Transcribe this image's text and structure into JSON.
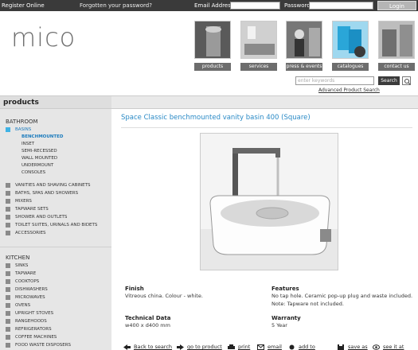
{
  "topbar": {
    "register": "Register Online",
    "forgot": "Forgotten your password?",
    "email_label": "Email Address:",
    "password_label": "Password:",
    "login": "Login"
  },
  "header": {
    "logo": "mico",
    "nav": [
      "products",
      "services",
      "press & events",
      "catalogues",
      "contact us"
    ],
    "search_placeholder": "enter keywords",
    "search_button": "Search",
    "advanced": "Advanced Product Search"
  },
  "sidebar": {
    "heading": "products",
    "bathroom_title": "BATHROOM",
    "basins": "BASINS",
    "basin_subs": [
      "BENCHMOUNTED",
      "INSET",
      "SEMI-RECESSED",
      "WALL MOUNTED",
      "UNDERMOUNT",
      "CONSOLES"
    ],
    "bathroom_items": [
      "VANITIES AND SHAVING CABINETS",
      "BATHS, SPAS AND SHOWERS",
      "MIXERS",
      "TAPWARE SETS",
      "SHOWER AND OUTLETS",
      "TOILET SUITES, URINALS AND BIDETS",
      "ACCESSORIES"
    ],
    "kitchen_title": "KITCHEN",
    "kitchen_items": [
      "SINKS",
      "TAPWARE",
      "COOKTOPS",
      "DISHWASHERS",
      "MICROWAVES",
      "OVENS",
      "UPRIGHT STOVES",
      "RANGEHOODS",
      "REFRIGERATORS",
      "COFFEE MACHINES",
      "FOOD WASTE DISPOSERS"
    ]
  },
  "product": {
    "title": "Space Classic benchmounted vanity basin 400 (Square)",
    "finish_label": "Finish",
    "finish_value": "Vitreous china. Colour - white.",
    "features_label": "Features",
    "features_line1": "No tap hole. Ceramic pop-up plug and waste included.",
    "features_line2": "Note: Tapware not included.",
    "tech_label": "Technical Data",
    "tech_value": "w400 x d400 mm",
    "warranty_label": "Warranty",
    "warranty_value": "5 Year"
  },
  "footer_links": [
    "Back to search",
    "go to product",
    "print",
    "email",
    "add to",
    "save as",
    "see it at"
  ],
  "colors": {
    "accent_blue": "#2a8ac6",
    "topbar": "#3a3a3a",
    "bullet_blue": "#3fb3e5"
  }
}
